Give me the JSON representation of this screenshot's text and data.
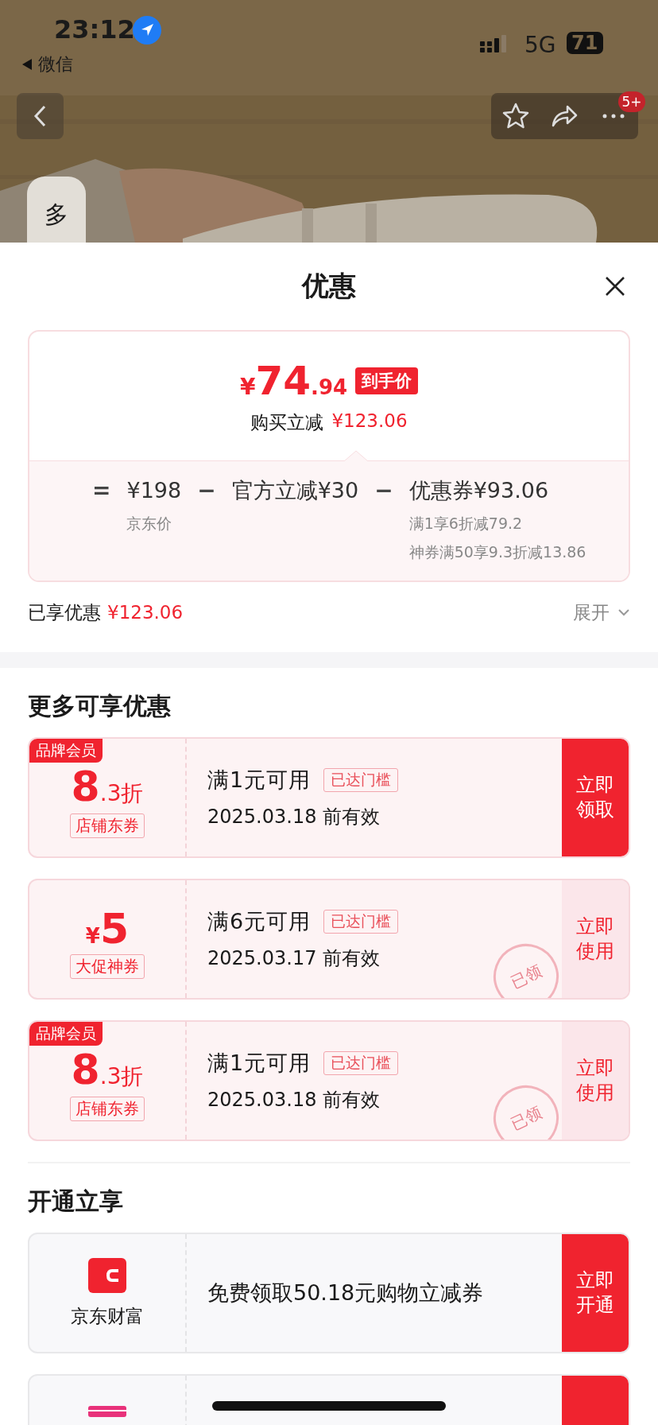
{
  "status_bar": {
    "time": "23:12",
    "back_label": "微信",
    "network": "5G",
    "battery": "71"
  },
  "nav": {
    "badge": "5+"
  },
  "side_tab": {
    "label": "多"
  },
  "sheet": {
    "title": "优惠"
  },
  "price_card": {
    "currency": "¥",
    "price_int": "74",
    "price_dec": ".94",
    "price_tag": "到手价",
    "saving_label": "购买立减",
    "saving_value": "¥123.06",
    "formula": [
      {
        "kind": "op",
        "text": "="
      },
      {
        "kind": "term",
        "text": "¥198",
        "notes": [
          "京东价"
        ]
      },
      {
        "kind": "op",
        "text": "−"
      },
      {
        "kind": "term",
        "text": "官方立减¥30"
      },
      {
        "kind": "op",
        "text": "−"
      },
      {
        "kind": "term",
        "text": "优惠券¥93.06",
        "notes": [
          "满1享6折减79.2",
          "神券满50享9.3折减13.86"
        ]
      }
    ]
  },
  "enjoyed": {
    "label": "已享优惠",
    "value": "¥123.06",
    "expand": "展开"
  },
  "more_section": {
    "title": "更多可享优惠",
    "coupons": [
      {
        "kind": "discount",
        "member_tag": "品牌会员",
        "amount_main": "8",
        "amount_sub": ".3折",
        "type_tag": "店铺东券",
        "condition": "满1元可用",
        "threshold_tag": "已达门槛",
        "validity": "2025.03.18 前有效",
        "action": "立即领取",
        "claimed": false
      },
      {
        "kind": "cash",
        "currency": "¥",
        "amount_main": "5",
        "type_tag": "大促神券",
        "condition": "满6元可用",
        "threshold_tag": "已达门槛",
        "validity": "2025.03.17 前有效",
        "action": "立即使用",
        "claimed": true,
        "stamp": "已领"
      },
      {
        "kind": "discount",
        "member_tag": "品牌会员",
        "amount_main": "8",
        "amount_sub": ".3折",
        "type_tag": "店铺东券",
        "condition": "满1元可用",
        "threshold_tag": "已达门槛",
        "validity": "2025.03.18 前有效",
        "action": "立即使用",
        "claimed": true,
        "stamp": "已领"
      }
    ]
  },
  "open_section": {
    "title": "开通立享",
    "offers": [
      {
        "kind": "wallet",
        "brand": "京东财富",
        "text": "免费领取50.18元购物立减券",
        "action": "立即开通"
      },
      {
        "kind": "card"
      }
    ]
  }
}
